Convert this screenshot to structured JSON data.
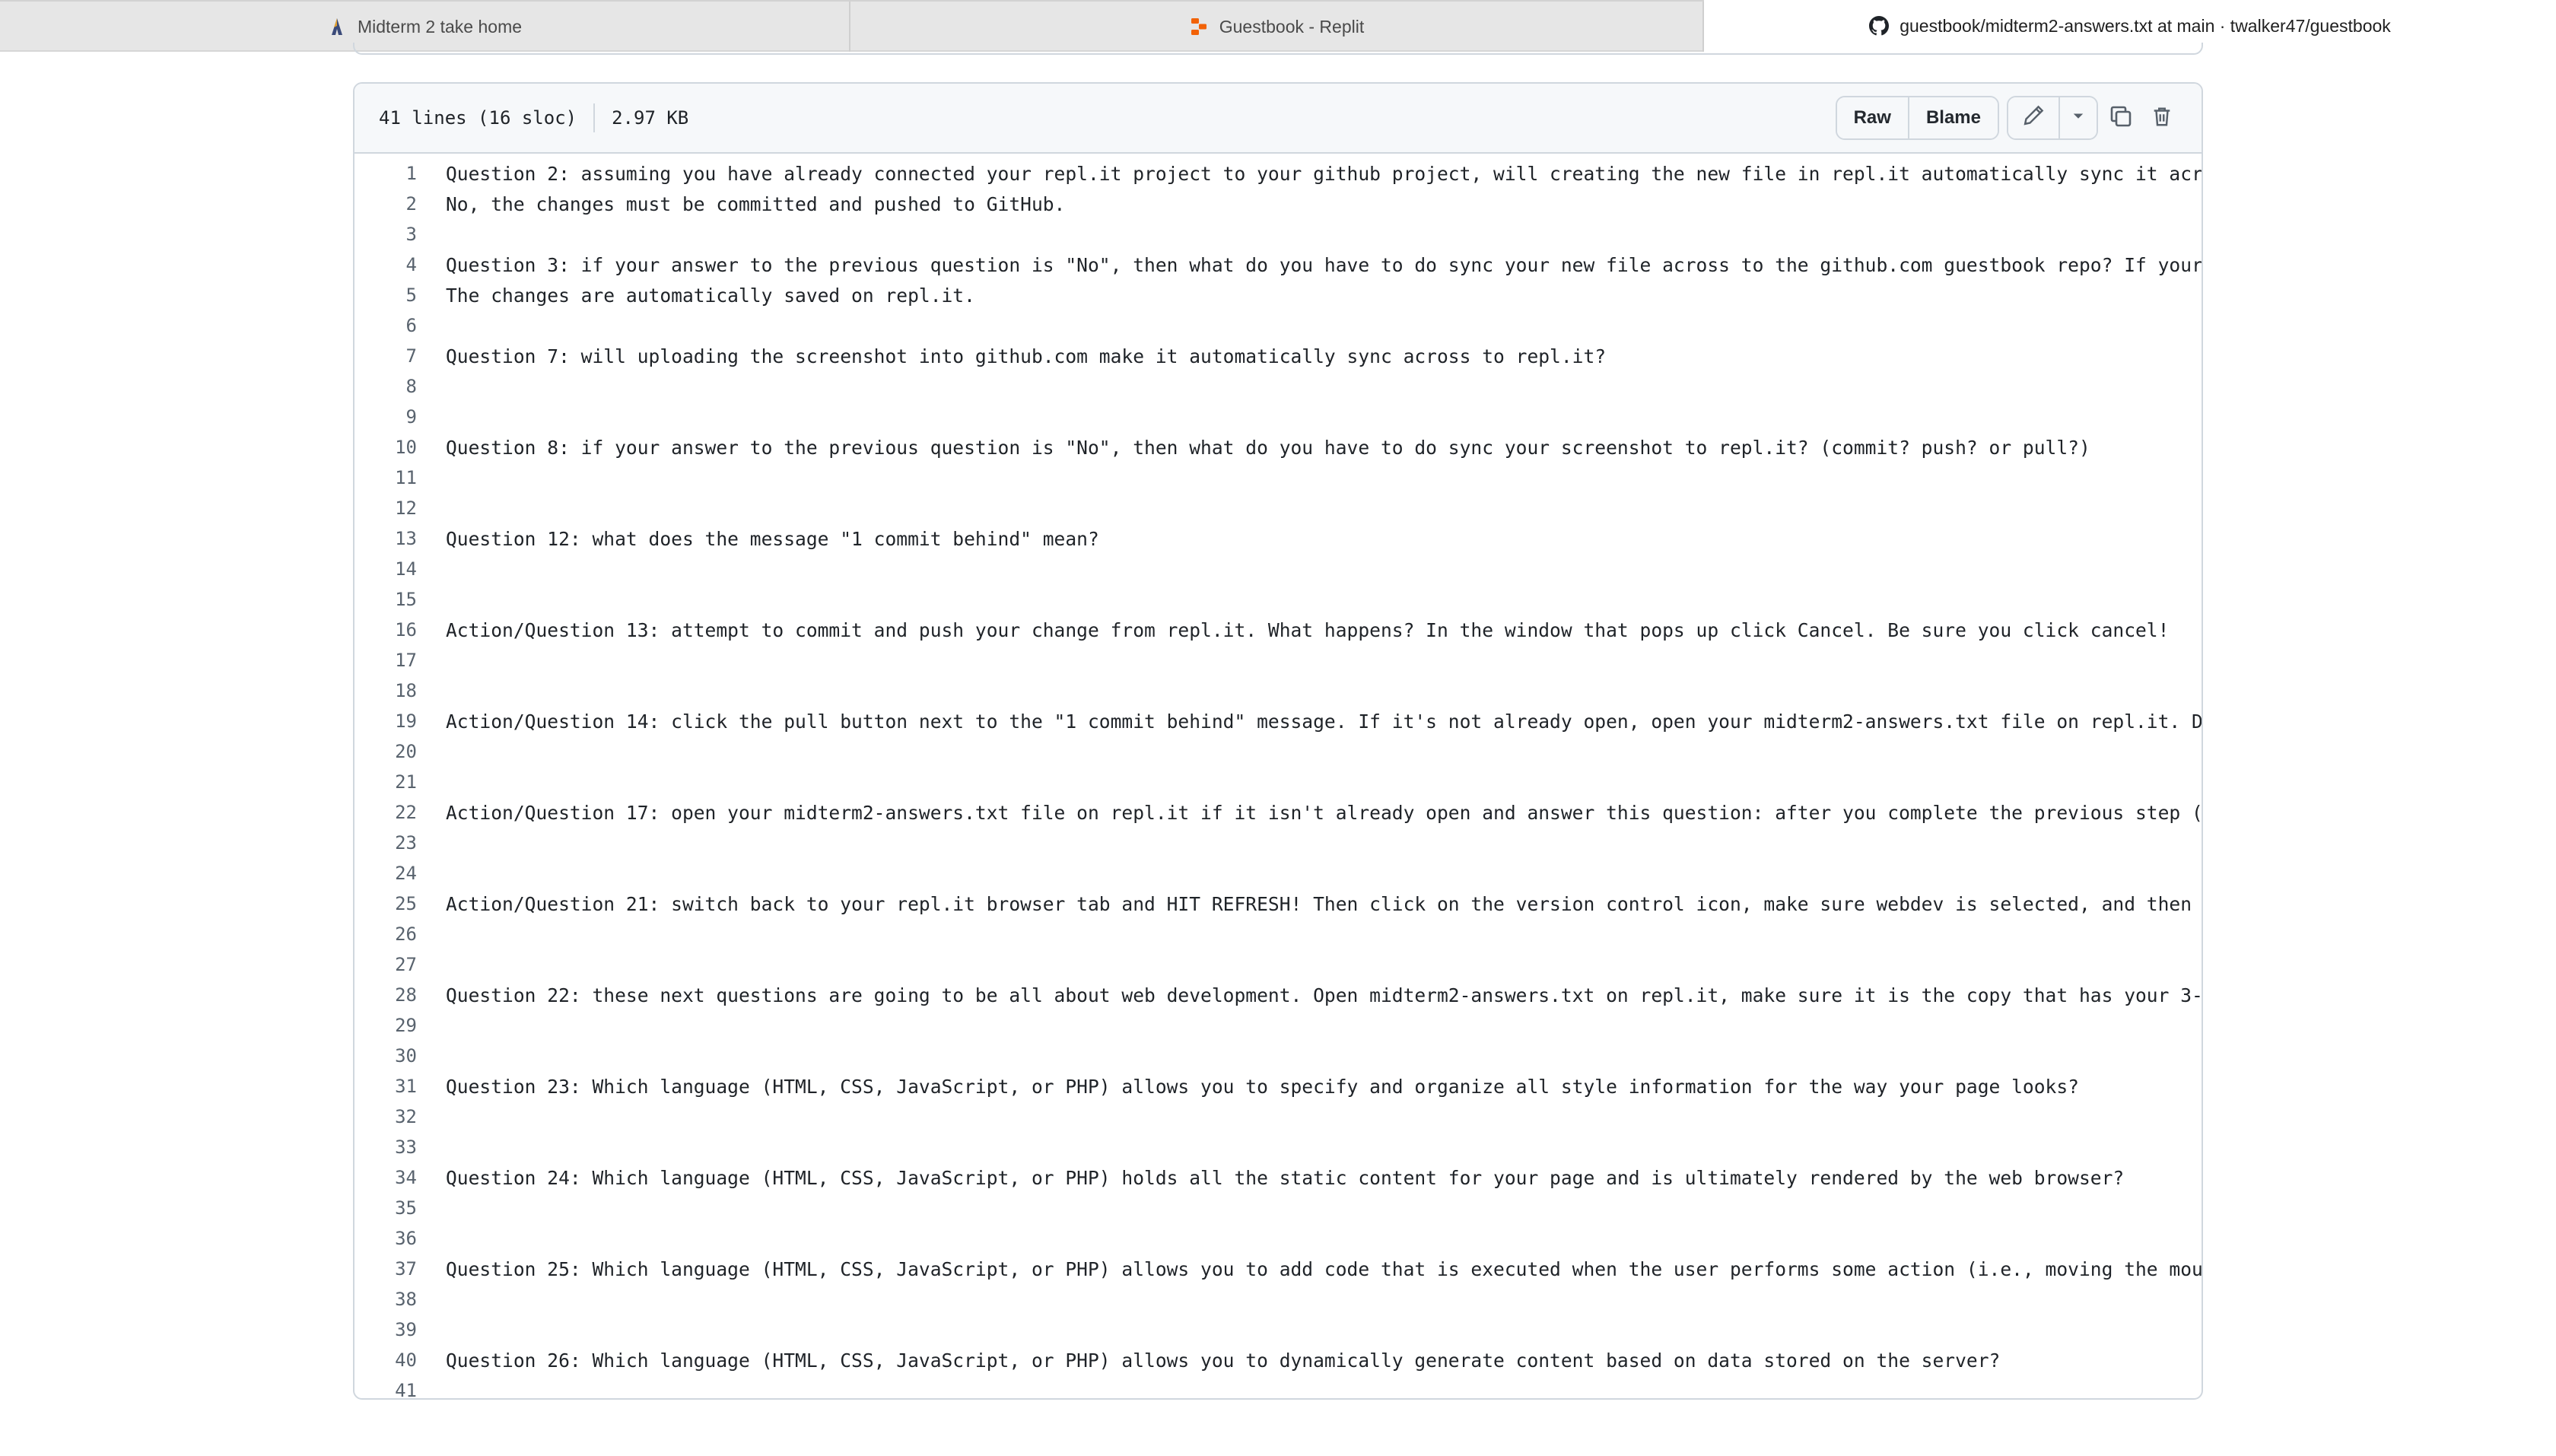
{
  "browser": {
    "tabs": [
      {
        "label": "Midterm 2 take home",
        "icon": "repl-logo-icon"
      },
      {
        "label": "Guestbook - Replit",
        "icon": "replit-icon"
      },
      {
        "label": "guestbook/midterm2-answers.txt at main · twalker47/guestbook",
        "icon": "github-icon"
      }
    ]
  },
  "file": {
    "lines_info": "41 lines (16 sloc)",
    "size": "2.97 KB",
    "raw_label": "Raw",
    "blame_label": "Blame"
  },
  "code_lines": [
    "Question 2: assuming you have already connected your repl.it project to your github project, will creating the new file in repl.it automatically sync it acr",
    "No, the changes must be committed and pushed to GitHub.",
    "",
    "Question 3: if your answer to the previous question is \"No\", then what do you have to do sync your new file across to the github.com guestbook repo? If your",
    "The changes are automatically saved on repl.it.",
    "",
    "Question 7: will uploading the screenshot into github.com make it automatically sync across to repl.it?",
    "",
    "",
    "Question 8: if your answer to the previous question is \"No\", then what do you have to do sync your screenshot to repl.it? (commit? push? or pull?)",
    "",
    "",
    "Question 12: what does the message \"1 commit behind\" mean?",
    "",
    "",
    "Action/Question 13: attempt to commit and push your change from repl.it. What happens? In the window that pops up click Cancel. Be sure you click cancel!",
    "",
    "",
    "Action/Question 14: click the pull button next to the \"1 commit behind\" message. If it's not already open, open your midterm2-answers.txt file on repl.it. D",
    "",
    "",
    "Action/Question 17: open your midterm2-answers.txt file on repl.it if it isn't already open and answer this question: after you complete the previous step (",
    "",
    "",
    "Action/Question 21: switch back to your repl.it browser tab and HIT REFRESH! Then click on the version control icon, make sure webdev is selected, and then",
    "",
    "",
    "Question 22: these next questions are going to be all about web development. Open midterm2-answers.txt on repl.it, make sure it is the copy that has your 3-",
    "",
    "",
    "Question 23: Which language (HTML, CSS, JavaScript, or PHP) allows you to specify and organize all style information for the way your page looks?",
    "",
    "",
    "Question 24: Which language (HTML, CSS, JavaScript, or PHP) holds all the static content for your page and is ultimately rendered by the web browser?",
    "",
    "",
    "Question 25: Which language (HTML, CSS, JavaScript, or PHP) allows you to add code that is executed when the user performs some action (i.e., moving the mou",
    "",
    "",
    "Question 26: Which language (HTML, CSS, JavaScript, or PHP) allows you to dynamically generate content based on data stored on the server?",
    ""
  ]
}
